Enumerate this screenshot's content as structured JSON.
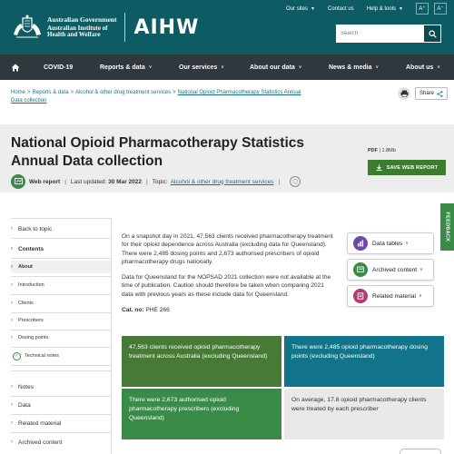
{
  "header": {
    "gov_line1": "Australian Government",
    "gov_line2": "Australian Institute of",
    "gov_line3": "Health and Welfare",
    "logo": "AIHW",
    "utility": {
      "our_sites": "Our sites",
      "contact": "Contact us",
      "help": "Help & tools",
      "font_up": "A⁺",
      "font_down": "A⁻"
    },
    "search_placeholder": "Search"
  },
  "nav": {
    "items": [
      "COVID-19",
      "Reports & data",
      "Our services",
      "About our data",
      "News & media",
      "About us"
    ]
  },
  "breadcrumb": {
    "items": [
      "Home",
      "Reports & data",
      "Alcohol & other drug treatment services"
    ],
    "current_line1": "National Opioid Pharmacotherapy Statistics Annual",
    "current_line2": "Data collection"
  },
  "actions": {
    "share": "Share"
  },
  "title": {
    "line1": "National Opioid Pharmacotherapy Statistics",
    "line2": "Annual Data collection"
  },
  "meta": {
    "type": "Web report",
    "updated_label": "Last updated:",
    "updated_value": "30 Mar 2022",
    "topic_label": "Topic:",
    "topic_value": "Alcohol & other drug treatment services"
  },
  "download": {
    "format": "PDF",
    "size": "1.8Mb",
    "save_label": "SAVE WEB REPORT"
  },
  "sidebar": {
    "back": "Back to topic",
    "contents": "Contents",
    "items": [
      "About",
      "Introduction",
      "Clients",
      "Prescribers",
      "Dosing points",
      "Technical notes"
    ],
    "bottom_items": [
      "Notes",
      "Data",
      "Related material",
      "Archived content"
    ]
  },
  "main": {
    "para1": "On a snapshot day in 2021, 47,563 clients received pharmacotherapy treatment for their opioid dependence across Australia (excluding data for Queensland). There were 2,485 dosing points and 2,673 authorised prescribers of opioid pharmacotherapy drugs nationally.",
    "para2": "Data for Queensland for the NOPSAD 2021 collection were not available at the time of publication. Caution should therefore be taken when comparing 2021 data with previous years as these include data for Queensland.",
    "cat_label": "Cat. no:",
    "cat_value": "PHE 266"
  },
  "right_cards": [
    "Data tables",
    "Archived content",
    "Related material"
  ],
  "feedback": "FEEDBACK",
  "tiles": [
    "47,563 clients received opioid pharmacotherapy treatment across Australia (excluding Queensland)",
    "There were 2,485 opioid pharmacotherapy dosing points (excluding Queensland)",
    "There were 2,673 authorised opioid pharmacotherapy prescribers (excluding Queensland)",
    "On average, 17.8 opioid pharmacotherapy clients were treated by each prescriber"
  ],
  "colors": {
    "header_teal": "#0d5c63",
    "nav_dark": "#30373d",
    "green": "#3a8a48",
    "tile_green": "#477a34",
    "tile_teal": "#12748a",
    "link": "#1a6f87"
  }
}
